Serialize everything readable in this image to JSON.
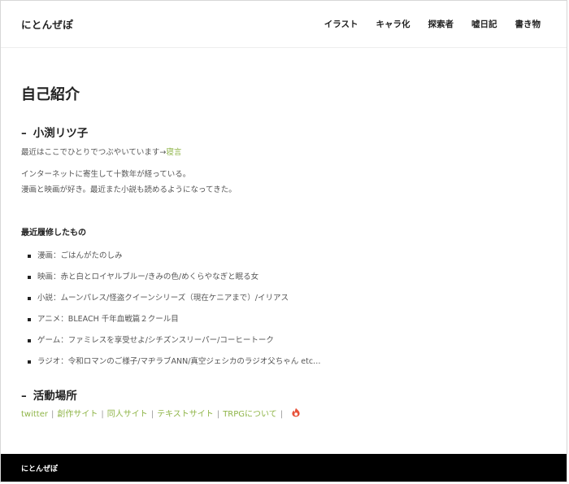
{
  "site": {
    "title": "にとんぜぽ"
  },
  "nav": {
    "items": [
      {
        "label": "イラスト"
      },
      {
        "label": "キャラ化"
      },
      {
        "label": "探索者"
      },
      {
        "label": "嘘日記"
      },
      {
        "label": "書き物"
      }
    ]
  },
  "main": {
    "page_title": "自己紹介",
    "profile": {
      "dash": "–",
      "name": "小渕リツ子",
      "intro_text": "最近はここでひとりでつぶやいています→",
      "intro_link": "寝言",
      "line1": "インターネットに寄生して十数年が経っている。",
      "line2": "漫画と映画が好き。最近また小説も読めるようになってきた。"
    },
    "history": {
      "heading": "最近履修したもの",
      "items": [
        {
          "text": "漫画：ごはんがたのしみ"
        },
        {
          "text": "映画：赤と白とロイヤルブルー/きみの色/めくらやなぎと眠る女"
        },
        {
          "text": "小説：ムーンパレス/怪盗クイーンシリーズ（現在ケニアまで）/イリアス"
        },
        {
          "text": "アニメ：BLEACH 千年血戦篇２クール目"
        },
        {
          "text": "ゲーム：ファミレスを享受せよ/シチズンスリーパー/コーヒートーク"
        },
        {
          "text": "ラジオ：令和ロマンのご様子/マヂラブANN/真空ジェシカのラジオ父ちゃん etc…"
        }
      ]
    },
    "activity": {
      "dash": "–",
      "heading": "活動場所",
      "links": [
        {
          "label": "twitter"
        },
        {
          "label": "創作サイト"
        },
        {
          "label": "同人サイト"
        },
        {
          "label": "テキストサイト"
        },
        {
          "label": "TRPGについて"
        }
      ],
      "separator": "|",
      "icon": "fire-icon"
    }
  },
  "footer": {
    "title": "にとんぜぽ"
  },
  "colors": {
    "accent": "#8fb548",
    "footer_bg": "#000000",
    "text": "#555555",
    "heading": "#222222",
    "icon": "#e8523a"
  }
}
